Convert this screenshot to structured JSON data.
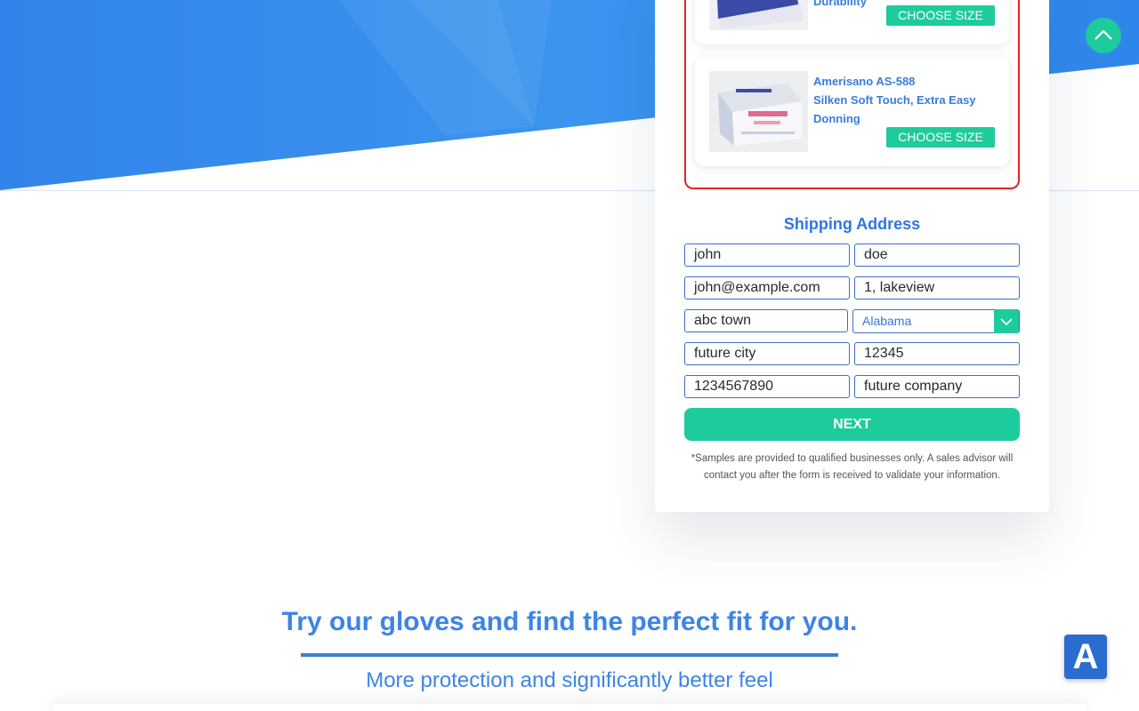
{
  "colors": {
    "hero_blue": "#3a8ef0",
    "accent_green": "#1ecb9c",
    "heading_blue": "#2f76e0",
    "highlight_red": "#e0242b"
  },
  "products": [
    {
      "title_tail": "Durability",
      "button_label": "CHOOSE SIZE"
    },
    {
      "title_line1": "Amerisano AS-588",
      "title_line2": "Silken Soft Touch, Extra Easy Donning",
      "button_label": "CHOOSE SIZE"
    }
  ],
  "shipping": {
    "title": "Shipping Address",
    "first_name": "john",
    "last_name": "doe",
    "email": "john@example.com",
    "address": "1, lakeview",
    "town": "abc town",
    "state": "Alabama",
    "city": "future city",
    "zip": "12345",
    "phone": "1234567890",
    "company": "future company",
    "next_label": "NEXT",
    "disclaimer": "*Samples are provided to qualified businesses only. A sales advisor will contact you after the form is received to validate your information."
  },
  "tagline": "Try our gloves and find the perfect fit for you.",
  "sub_tagline": "More protection and significantly better feel",
  "chat_widget_letter": "A",
  "icons": {
    "scroll_top": "chevron-up-icon",
    "select_arrow": "chevron-down-icon"
  }
}
